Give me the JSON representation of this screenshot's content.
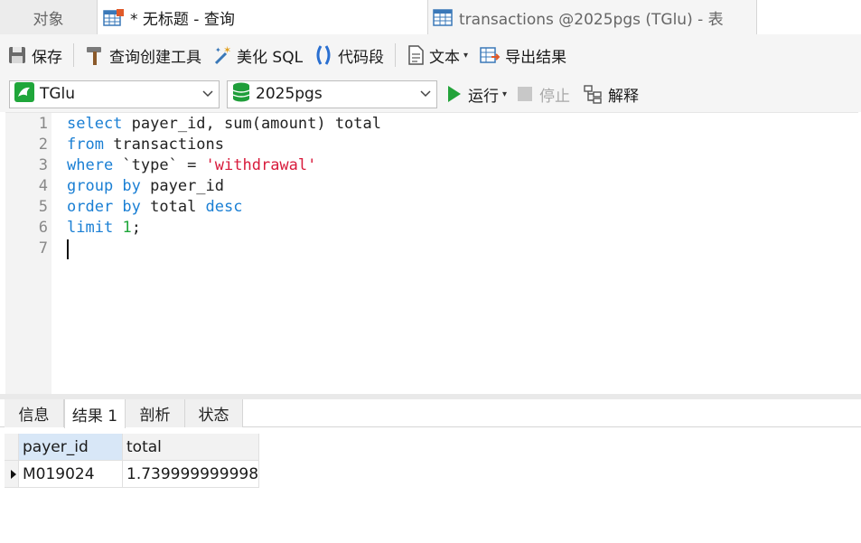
{
  "tabs": {
    "objects": "对象",
    "query": "* 无标题 - 查询",
    "table": "transactions @2025pgs (TGlu) - 表"
  },
  "toolbar": {
    "save": "保存",
    "query_builder": "查询创建工具",
    "beautify": "美化 SQL",
    "snippet": "代码段",
    "text": "文本",
    "export": "导出结果"
  },
  "connection": {
    "name": "TGlu",
    "database": "2025pgs",
    "run": "运行",
    "stop": "停止",
    "explain": "解释"
  },
  "editor": {
    "line_numbers": [
      "1",
      "2",
      "3",
      "4",
      "5",
      "6",
      "7"
    ],
    "lines": [
      [
        {
          "t": "select",
          "c": "kw"
        },
        {
          "t": " payer_id, sum(amount) total",
          "c": "txt"
        }
      ],
      [
        {
          "t": "from",
          "c": "kw"
        },
        {
          "t": " transactions",
          "c": "txt"
        }
      ],
      [
        {
          "t": "where",
          "c": "kw"
        },
        {
          "t": " `type` = ",
          "c": "txt"
        },
        {
          "t": "'withdrawal'",
          "c": "str"
        }
      ],
      [
        {
          "t": "group by",
          "c": "kw"
        },
        {
          "t": " payer_id",
          "c": "txt"
        }
      ],
      [
        {
          "t": "order by",
          "c": "kw"
        },
        {
          "t": " total ",
          "c": "txt"
        },
        {
          "t": "desc",
          "c": "kw"
        }
      ],
      [
        {
          "t": "limit",
          "c": "kw"
        },
        {
          "t": " ",
          "c": "txt"
        },
        {
          "t": "1",
          "c": "num"
        },
        {
          "t": ";",
          "c": "txt"
        }
      ],
      []
    ]
  },
  "result_tabs": [
    "信息",
    "结果 1",
    "剖析",
    "状态"
  ],
  "result": {
    "columns": [
      "payer_id",
      "total"
    ],
    "rows": [
      [
        "M019024",
        "1.739999999998"
      ]
    ]
  },
  "colors": {
    "keyword": "#1a7fd4",
    "string": "#d81b3c",
    "number": "#1fa63a",
    "run": "#23a33a",
    "db_icon": "#1f9e3a"
  }
}
